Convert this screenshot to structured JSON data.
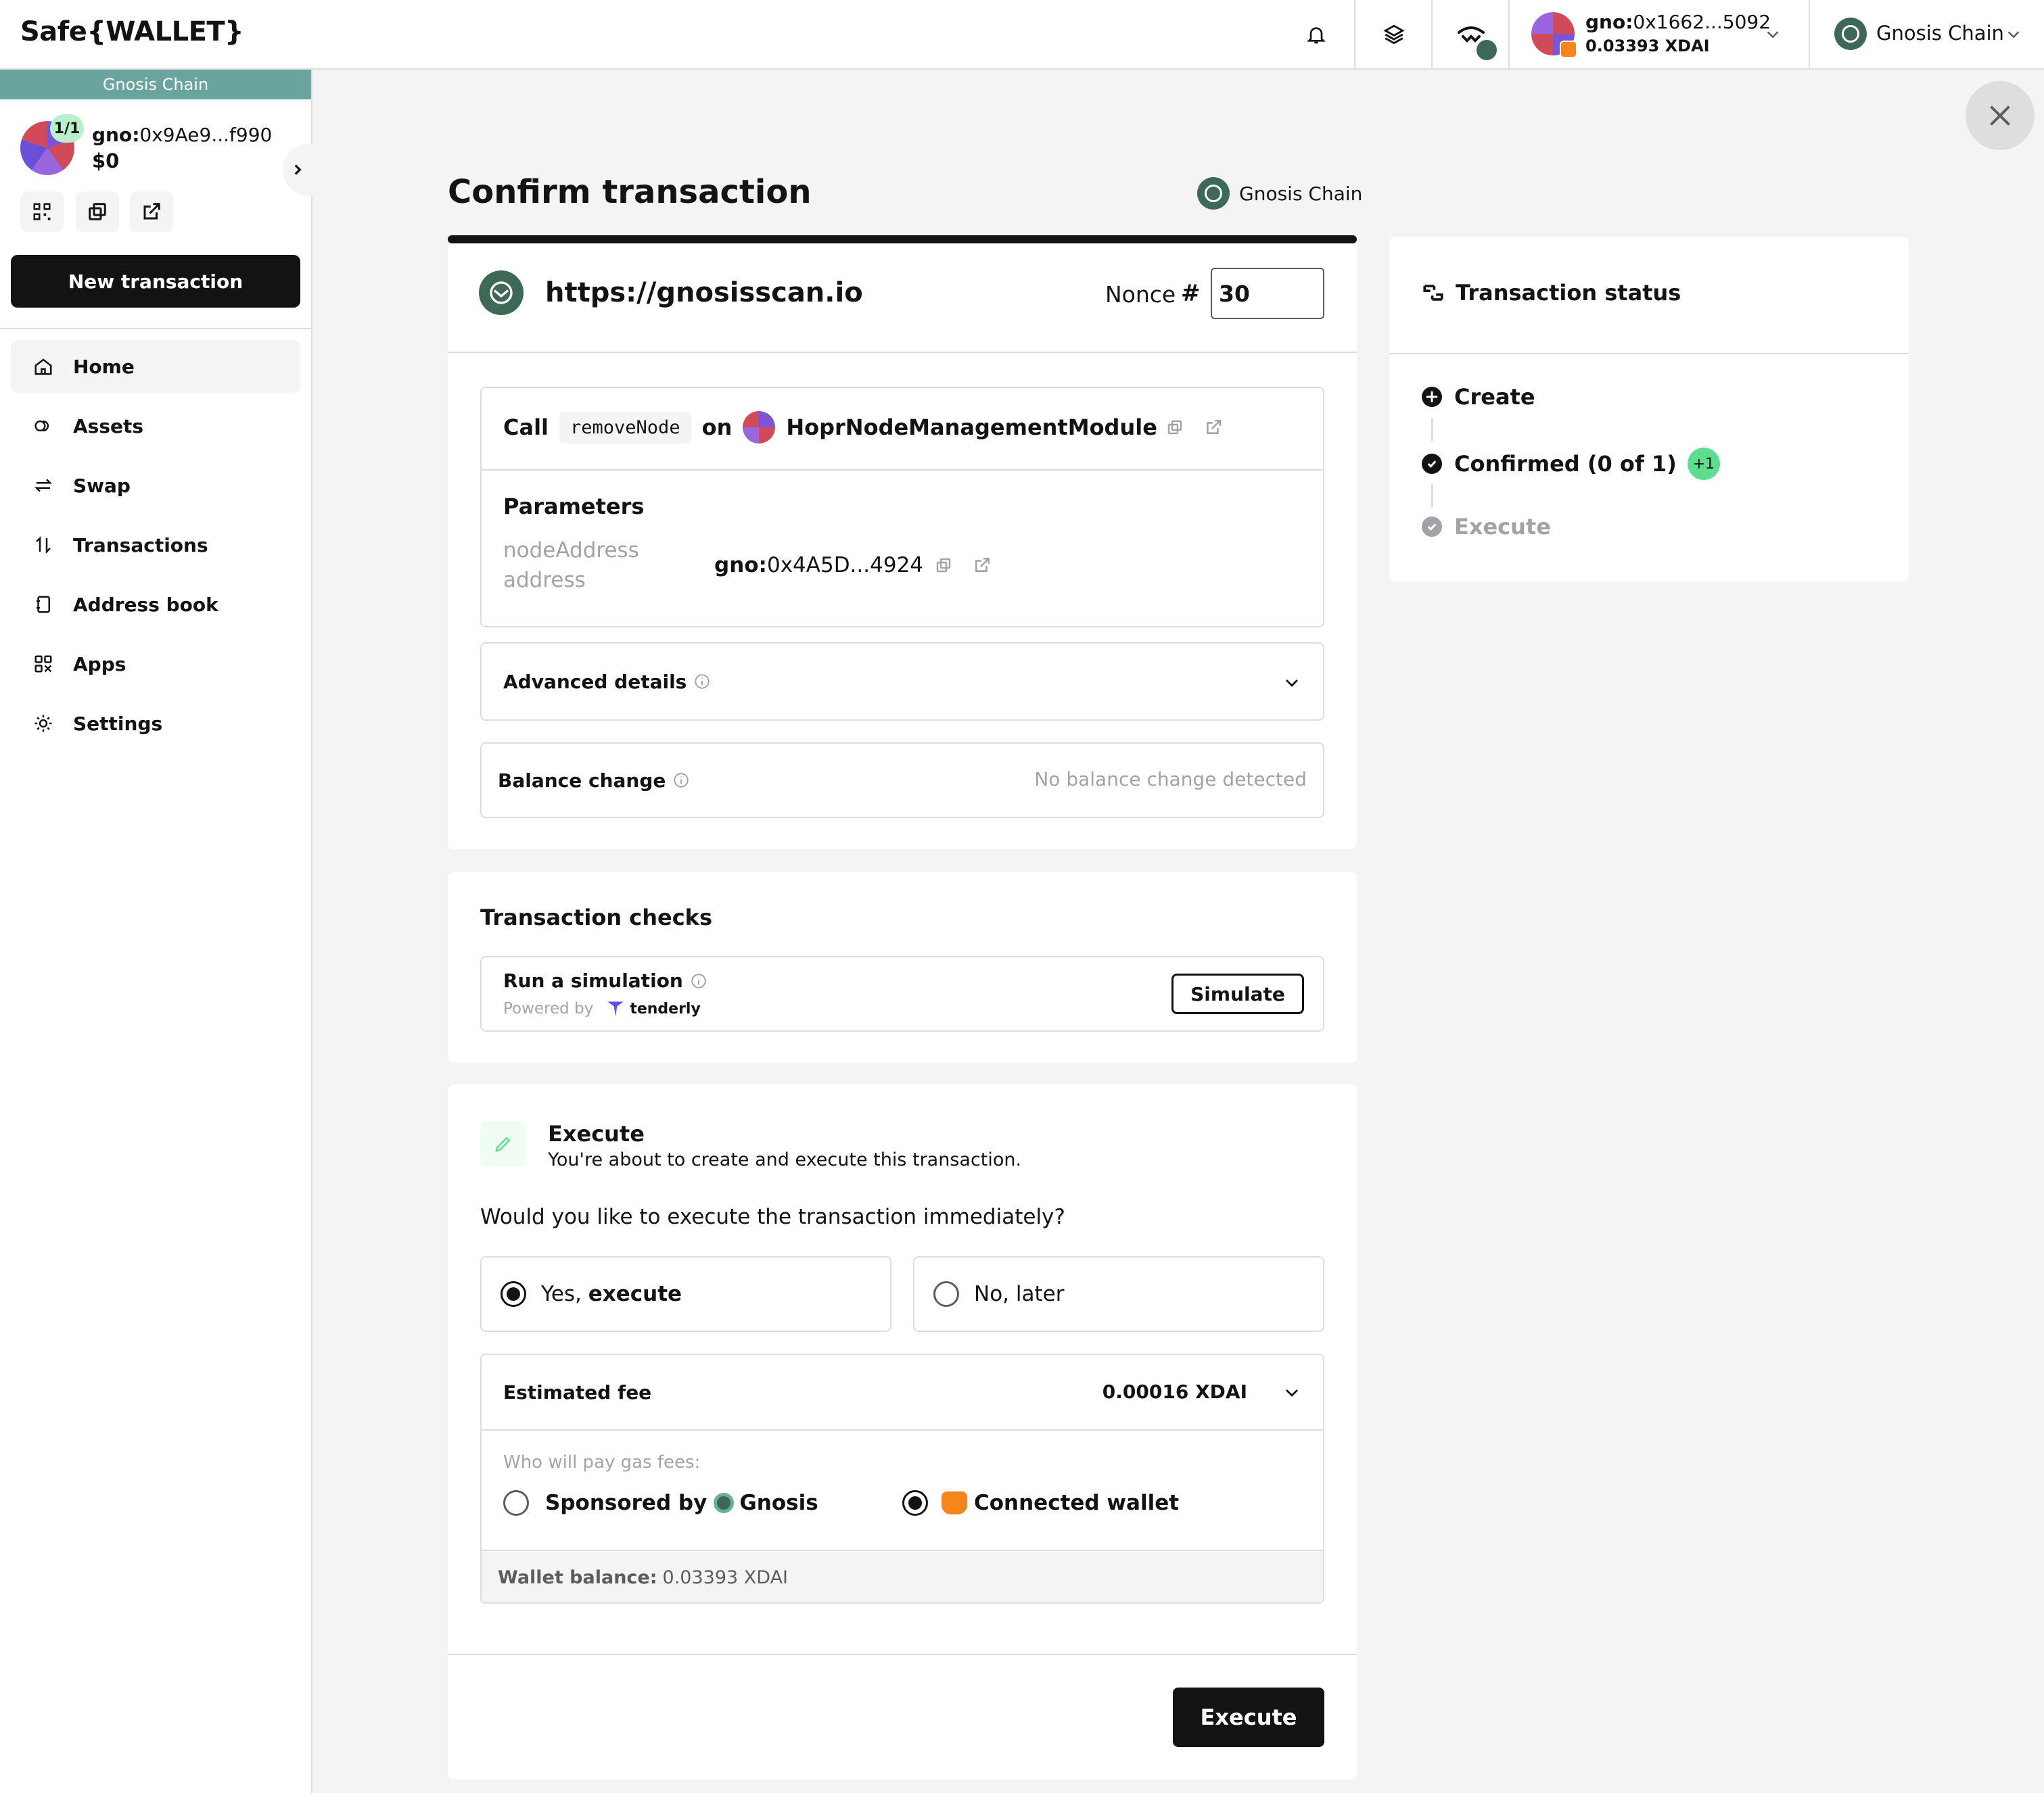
{
  "header": {
    "logo": "Safe{WALLET}",
    "account_prefix": "gno:",
    "account_address": "0x1662...5092",
    "account_balance": "0.03393 XDAI",
    "network": "Gnosis Chain"
  },
  "sidebar": {
    "chain_banner": "Gnosis Chain",
    "threshold": "1/1",
    "safe_prefix": "gno:",
    "safe_address": "0x9Ae9...f990",
    "safe_balance": "$0",
    "new_tx_label": "New transaction",
    "items": [
      {
        "label": "Home",
        "icon": "home-icon",
        "active": true
      },
      {
        "label": "Assets",
        "icon": "assets-icon"
      },
      {
        "label": "Swap",
        "icon": "swap-icon"
      },
      {
        "label": "Transactions",
        "icon": "transactions-icon"
      },
      {
        "label": "Address book",
        "icon": "address-book-icon"
      },
      {
        "label": "Apps",
        "icon": "apps-icon"
      },
      {
        "label": "Settings",
        "icon": "settings-icon"
      }
    ]
  },
  "main": {
    "title": "Confirm transaction",
    "chain_label": "Gnosis Chain",
    "origin": "https://gnosisscan.io",
    "nonce_label": "Nonce",
    "nonce_hash": "#",
    "nonce_value": "30",
    "call": {
      "call_label": "Call",
      "method": "removeNode",
      "on_label": "on",
      "contract": "HoprNodeManagementModule"
    },
    "params": {
      "title": "Parameters",
      "name": "nodeAddress",
      "type": "address",
      "value_prefix": "gno:",
      "value": "0x4A5D...4924"
    },
    "advanced_label": "Advanced details",
    "balance_change_label": "Balance change",
    "balance_change_value": "No balance change detected",
    "checks": {
      "title": "Transaction checks",
      "simulation_label": "Run a simulation",
      "powered_by": "Powered by",
      "provider": "tenderly",
      "simulate_button": "Simulate"
    },
    "execute_section": {
      "title": "Execute",
      "subtitle": "You're about to create and execute this transaction.",
      "question": "Would you like to execute the transaction immediately?",
      "yes_prefix": "Yes, ",
      "yes_bold": "execute",
      "no_label": "No, later",
      "fee_label": "Estimated fee",
      "fee_value": "0.00016 XDAI",
      "gas_question": "Who will pay gas fees:",
      "sponsored_label": "Sponsored by",
      "sponsored_by": "Gnosis",
      "connected_wallet": "Connected wallet",
      "wallet_balance_label": "Wallet balance:",
      "wallet_balance_value": "0.03393 XDAI",
      "execute_button": "Execute"
    }
  },
  "status": {
    "title": "Transaction status",
    "steps": [
      {
        "label": "Create",
        "state": "done"
      },
      {
        "label": "Confirmed (0 of 1)",
        "state": "done",
        "badge": "+1"
      },
      {
        "label": "Execute",
        "state": "pending"
      }
    ]
  },
  "colors": {
    "gnosis_green": "#3e6957",
    "banner_teal": "#69a59e",
    "badge_green": "#5fdd8f",
    "dark": "#121312"
  }
}
